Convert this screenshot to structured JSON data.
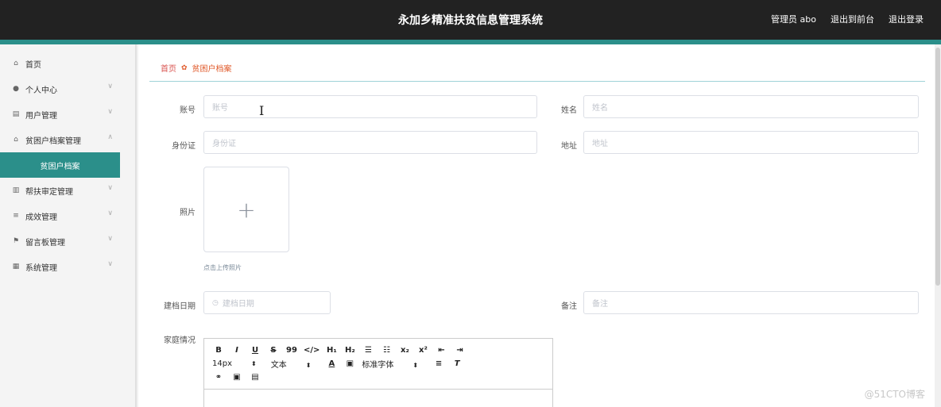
{
  "header": {
    "title": "永加乡精准扶贫信息管理系统",
    "admin": "管理员 abo",
    "goto_front": "退出到前台",
    "logout": "退出登录"
  },
  "sidebar": {
    "items": [
      {
        "label": "首页",
        "icon": "home-icon"
      },
      {
        "label": "个人中心",
        "icon": "user-icon"
      },
      {
        "label": "用户管理",
        "icon": "doc-icon"
      },
      {
        "label": "贫困户档案管理",
        "icon": "house-icon"
      },
      {
        "label": "帮扶审定管理",
        "icon": "chart-icon"
      },
      {
        "label": "成效管理",
        "icon": "list-icon"
      },
      {
        "label": "留言板管理",
        "icon": "flag-icon"
      },
      {
        "label": "系统管理",
        "icon": "grid-icon"
      }
    ],
    "active_sub": "贫困户档案"
  },
  "breadcrumb": {
    "home": "首页",
    "current": "贫困户档案"
  },
  "form": {
    "account": {
      "label": "账号",
      "placeholder": "账号"
    },
    "name": {
      "label": "姓名",
      "placeholder": "姓名"
    },
    "idcard": {
      "label": "身份证",
      "placeholder": "身份证"
    },
    "address": {
      "label": "地址",
      "placeholder": "地址"
    },
    "photo": {
      "label": "照片",
      "hint": "点击上传照片"
    },
    "date": {
      "label": "建档日期",
      "placeholder": "建档日期"
    },
    "remark": {
      "label": "备注",
      "placeholder": "备注"
    },
    "family": {
      "label": "家庭情况"
    }
  },
  "editor": {
    "row1": [
      "B",
      "I",
      "U",
      "S",
      "99",
      "</>",
      "H₁",
      "H₂",
      "☰",
      "☷",
      "x₂",
      "x²",
      "⇤",
      "⇥"
    ],
    "font_size": "14px",
    "text_type": "文本",
    "font_family": "标准字体",
    "row3": [
      "🔗",
      "▣",
      "▤"
    ]
  },
  "watermark": "@51CTO博客",
  "colors": {
    "topbar": "#222222",
    "accent": "#2b8f8a",
    "breadcrumb_current": "#e05a2b"
  }
}
